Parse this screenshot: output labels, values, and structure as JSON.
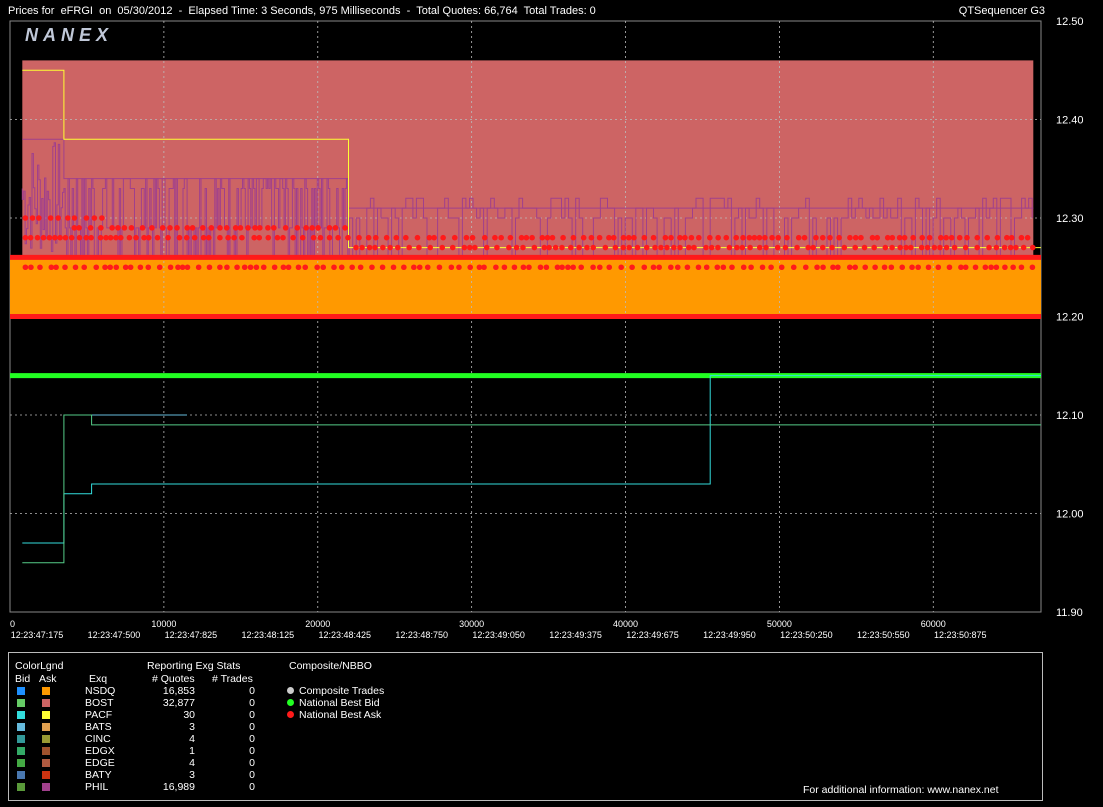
{
  "header": {
    "left_title": "Prices for  eFRGI  on  05/30/2012  -  Elapsed Time: 3 Seconds, 975 Milliseconds  -  Total Quotes: 66,764  Total Trades: 0",
    "right_title": "QTSequencer G3",
    "logo_text": "NANEX"
  },
  "colors": {
    "background": "#000000",
    "ask_fill": "#cd6464",
    "bid_fill": "#ff9900",
    "nbbo_ask": "#ff1a1a",
    "nbbo_bid": "#22ff22",
    "grid": "#bbbbbb",
    "phil_ask_line": "#a0408c",
    "pacf_ask_line": "#ffff33",
    "pacf_bid_line": "#33dddd",
    "bats_bid_line": "#66bbdd"
  },
  "chart_data": {
    "type": "line",
    "title": "Prices for  eFRGI  on  05/30/2012",
    "xlabel": "",
    "ylabel": "",
    "xlim": [
      0,
      67000
    ],
    "ylim": [
      11.9,
      12.5
    ],
    "grid": true,
    "y_ticks": [
      "12.50",
      "12.40",
      "12.30",
      "12.20",
      "12.10",
      "12.00",
      "11.90"
    ],
    "y_tick_values": [
      12.5,
      12.4,
      12.3,
      12.2,
      12.1,
      12.0,
      11.9
    ],
    "x_ticks": [
      "0",
      "10000",
      "20000",
      "30000",
      "40000",
      "50000",
      "60000"
    ],
    "x_tick_values": [
      0,
      10000,
      20000,
      30000,
      40000,
      50000,
      60000
    ],
    "x_time_labels": [
      "12:23:47:175",
      "12:23:47:500",
      "12:23:47:825",
      "12:23:48:125",
      "12:23:48:425",
      "12:23:48:750",
      "12:23:49:050",
      "12:23:49:375",
      "12:23:49:675",
      "12:23:49:950",
      "12:23:50:250",
      "12:23:50:550",
      "12:23:50:875"
    ],
    "x_time_label_values": [
      0,
      5000,
      10000,
      15000,
      20000,
      25000,
      30000,
      35000,
      40000,
      45000,
      50000,
      55000,
      60000
    ],
    "bands": [
      {
        "name": "ask-range",
        "x": [
          800,
          66500
        ],
        "y": [
          12.26,
          12.46
        ],
        "color": "#cd6464"
      },
      {
        "name": "bid-range",
        "x": [
          0,
          67000
        ],
        "y": [
          12.2,
          12.26
        ],
        "color": "#ff9900"
      }
    ],
    "series": [
      {
        "name": "National Best Ask",
        "color": "#ff1a1a",
        "x": [
          0,
          67000
        ],
        "y": [
          12.26,
          12.26
        ]
      },
      {
        "name": "National Best Ask",
        "color": "#ff1a1a",
        "x": [
          0,
          67000
        ],
        "y": [
          12.2,
          12.2
        ]
      },
      {
        "name": "National Best Bid",
        "color": "#22ff22",
        "x": [
          0,
          67000
        ],
        "y": [
          12.14,
          12.14
        ]
      },
      {
        "name": "PHIL",
        "color": "#a0408c",
        "x": [
          800,
          3500,
          3500,
          22000,
          22000,
          66500
        ],
        "y": [
          12.38,
          12.38,
          12.34,
          12.34,
          12.31,
          12.31
        ]
      },
      {
        "name": "PACF",
        "color": "#ffff33",
        "x": [
          800,
          3500,
          3500,
          22000,
          22000,
          67000
        ],
        "y": [
          12.45,
          12.45,
          12.38,
          12.38,
          12.27,
          12.27
        ]
      },
      {
        "name": "PACF",
        "color": "#33dddd",
        "x": [
          800,
          3500,
          3500,
          5300,
          5300,
          45500,
          45500,
          67000
        ],
        "y": [
          11.97,
          11.97,
          12.02,
          12.02,
          12.03,
          12.03,
          12.14,
          12.14
        ]
      },
      {
        "name": "BATS",
        "color": "#66bbdd",
        "x": [
          3500,
          11500
        ],
        "y": [
          12.1,
          12.1
        ]
      },
      {
        "name": "BOST",
        "color": "#55cc88",
        "x": [
          800,
          3500,
          3500,
          5300,
          5300,
          67000
        ],
        "y": [
          11.95,
          11.95,
          12.1,
          12.1,
          12.09,
          12.09
        ]
      }
    ],
    "red_ask_dot_levels": [
      12.3,
      12.29,
      12.28,
      12.27,
      12.25
    ]
  },
  "legend": {
    "colorlgnd_title": "ColorLgnd",
    "bid_label": "Bid",
    "ask_label": "Ask",
    "exq_label": "Exq",
    "stats_title": "Reporting Exg Stats",
    "quotes_label": "# Quotes",
    "trades_label": "# Trades",
    "composite_title": "Composite/NBBO",
    "composite_items": [
      {
        "label": "Composite Trades",
        "color": "#cccccc"
      },
      {
        "label": "National Best Bid",
        "color": "#22ff22"
      },
      {
        "label": "National Best Ask",
        "color": "#ff1a1a"
      }
    ],
    "exchanges": [
      {
        "name": "NSDQ",
        "quotes": "16,853",
        "trades": "0",
        "bid_color": "#1e90ff",
        "ask_color": "#ff9900"
      },
      {
        "name": "BOST",
        "quotes": "32,877",
        "trades": "0",
        "bid_color": "#66cc66",
        "ask_color": "#cd6464"
      },
      {
        "name": "PACF",
        "quotes": "30",
        "trades": "0",
        "bid_color": "#33dddd",
        "ask_color": "#ffff33"
      },
      {
        "name": "BATS",
        "quotes": "3",
        "trades": "0",
        "bid_color": "#66bbdd",
        "ask_color": "#e0a050"
      },
      {
        "name": "CINC",
        "quotes": "4",
        "trades": "0",
        "bid_color": "#339999",
        "ask_color": "#999933"
      },
      {
        "name": "EDGX",
        "quotes": "1",
        "trades": "0",
        "bid_color": "#33aa66",
        "ask_color": "#a0522d"
      },
      {
        "name": "EDGE",
        "quotes": "4",
        "trades": "0",
        "bid_color": "#44aa44",
        "ask_color": "#b05a40"
      },
      {
        "name": "BATY",
        "quotes": "3",
        "trades": "0",
        "bid_color": "#4a78b0",
        "ask_color": "#cc3311"
      },
      {
        "name": "PHIL",
        "quotes": "16,989",
        "trades": "0",
        "bid_color": "#5a9a3a",
        "ask_color": "#a0408c"
      }
    ],
    "footer": "For additional information: www.nanex.net"
  }
}
